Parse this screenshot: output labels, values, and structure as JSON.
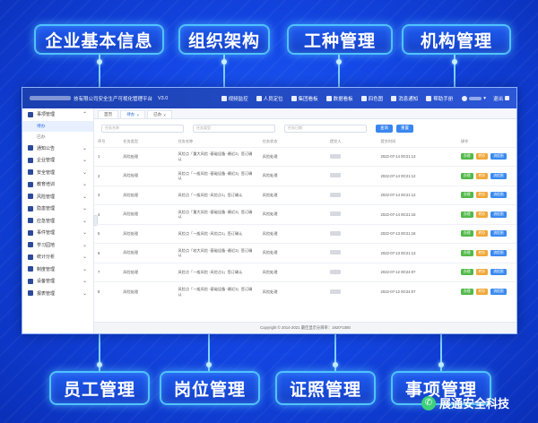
{
  "top_labels": [
    "企业基本信息",
    "组织架构",
    "工种管理",
    "机构管理"
  ],
  "bottom_labels": [
    "员工管理",
    "岗位管理",
    "证照管理",
    "事项管理"
  ],
  "brand": {
    "name": "展通安全科技",
    "logo_icon": "wechat-icon"
  },
  "app": {
    "title": "技有限公司安全生产可视化管理平台",
    "version": "V3.0",
    "top_menu": [
      {
        "label": "视频监控",
        "icon": "video-icon"
      },
      {
        "label": "人员定位",
        "icon": "location-icon"
      },
      {
        "label": "集团看板",
        "icon": "dashboard-icon"
      },
      {
        "label": "数据看板",
        "icon": "chart-icon"
      },
      {
        "label": "四色图",
        "icon": "map-icon"
      },
      {
        "label": "消息通知",
        "icon": "bell-icon"
      },
      {
        "label": "帮助手册",
        "icon": "book-icon"
      }
    ],
    "logout": "退出",
    "sidebar": [
      {
        "label": "事项管理",
        "expanded": true,
        "children": [
          {
            "label": "待办",
            "active": true
          },
          {
            "label": "已办",
            "active": false
          }
        ]
      },
      {
        "label": "通知公告"
      },
      {
        "label": "企业管理"
      },
      {
        "label": "安全管理"
      },
      {
        "label": "教育培训"
      },
      {
        "label": "风险管理"
      },
      {
        "label": "隐患管理"
      },
      {
        "label": "应急管理"
      },
      {
        "label": "事件管理"
      },
      {
        "label": "学习园地"
      },
      {
        "label": "统计分析"
      },
      {
        "label": "制度管理"
      },
      {
        "label": "设备管理"
      },
      {
        "label": "报表管理"
      }
    ],
    "tabs": [
      {
        "label": "首页",
        "active": false
      },
      {
        "label": "待办",
        "active": true
      },
      {
        "label": "已办",
        "active": false
      }
    ],
    "filters": {
      "name_placeholder": "任务名称",
      "type_placeholder": "任务类型",
      "date_placeholder": "任务日期",
      "search_label": "查询",
      "reset_label": "重置"
    },
    "table": {
      "headers": [
        "序号",
        "任务类型",
        "任务名称",
        "任务状态",
        "提交人",
        "提交时间",
        "操作"
      ],
      "rows": [
        {
          "no": "1",
          "type": "风险处理",
          "name": "风险点「重大风险 -基础设备 -最近2」签订确认",
          "status": "风险处理",
          "time": "2022-07-14 00:21:13"
        },
        {
          "no": "2",
          "type": "风险处理",
          "name": "风险点「一般风险 -基础设备 -最近3」签订确认",
          "status": "风险处理",
          "time": "2022-07-14 00:21:12"
        },
        {
          "no": "3",
          "type": "风险处理",
          "name": "风险点「一般风险 -风险点1」签订确认",
          "status": "风险处理",
          "time": "2022-07-14 00:21:12"
        },
        {
          "no": "4",
          "type": "风险处理",
          "name": "风险点「重大风险 -基础设备 -最近3」签订确认",
          "status": "风险处理",
          "time": "2022-07-14 00:21:16"
        },
        {
          "no": "5",
          "type": "风险处理",
          "name": "风险点「一般风险 -风险点1」签订确认",
          "status": "风险处理",
          "time": "2022-07-13 00:21:16"
        },
        {
          "no": "6",
          "type": "风险处理",
          "name": "风险点「较大风险 -基础设备 -最近3」签订确认",
          "status": "风险处理",
          "time": "2022-07-13 00:21:13"
        },
        {
          "no": "7",
          "type": "风险处理",
          "name": "风险点「一般风险 -风险点1」签订确认",
          "status": "风险处理",
          "time": "2022-07-12 00:24:07"
        },
        {
          "no": "8",
          "type": "风险处理",
          "name": "风险点「一般风险 -基础设备 -最近3」签订确认",
          "status": "风险处理",
          "time": "2022-07-12 00:24:07"
        }
      ],
      "actions": [
        "办理",
        "转办",
        "流程图"
      ]
    },
    "footer": "Copyright © 2014-2021 最佳显示分辨率：1920*1080"
  }
}
